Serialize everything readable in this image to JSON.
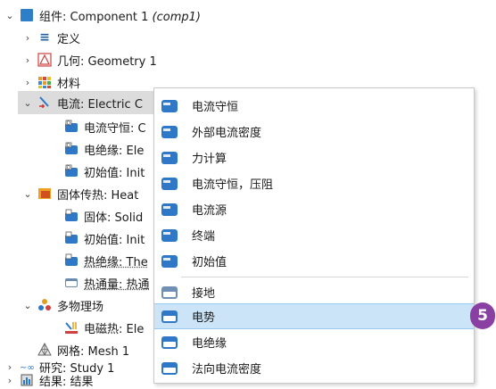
{
  "tree": {
    "component": "组件: Component 1",
    "component_tag": "(comp1)",
    "definitions": "定义",
    "geometry": "几何: Geometry 1",
    "materials": "材料",
    "electric_currents": "电流: Electric C",
    "ec_children": [
      "电流守恒: C",
      "电绝缘: Ele",
      "初始值: Init"
    ],
    "heat_transfer": "固体传热: Heat",
    "ht_children": [
      "固体: Solid",
      "初始值: Init",
      "热绝缘: The",
      "热通量: 热通"
    ],
    "multiphysics": "多物理场",
    "mp_children": [
      "电磁热: Ele"
    ],
    "mesh": "网格: Mesh 1",
    "study": "研究: Study 1",
    "results": "结果: 结果"
  },
  "context_menu": {
    "domain_items": [
      "电流守恒",
      "外部电流密度",
      "力计算",
      "电流守恒，压阻",
      "电流源",
      "终端",
      "初始值"
    ],
    "boundary_items": [
      "接地",
      "电势",
      "电绝缘",
      "法向电流密度"
    ],
    "highlighted": "电势"
  },
  "badge": "5",
  "colors": {
    "domain_icon": "#2e78c7",
    "boundary_icon": "#2e78c7",
    "highlight": "#cce4f7",
    "badge": "#8a3fa3",
    "selected_row": "#dcdcdc"
  }
}
